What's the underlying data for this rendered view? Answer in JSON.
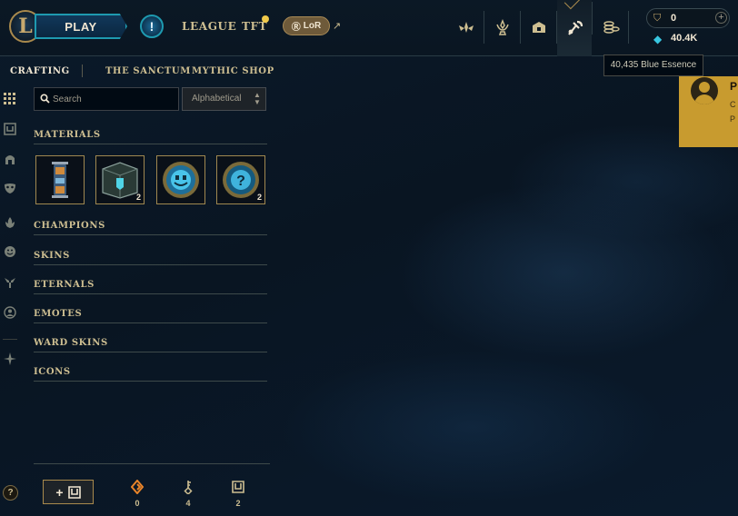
{
  "topbar": {
    "play_label": "PLAY",
    "alert_label": "!",
    "nav_league": "LEAGUE",
    "nav_tft": "TFT",
    "lor_label": "LoR",
    "lor_ext": "↗"
  },
  "wallet": {
    "rp_value": "0",
    "rp_add": "+",
    "be_value": "40.4K",
    "tooltip": "40,435 Blue Essence"
  },
  "notification": {
    "title": "P",
    "line1": "C",
    "line2": "P"
  },
  "subnav": {
    "crafting": "CRAFTING",
    "sanctum": "THE SANCTUM",
    "mythic_shop": "MYTHIC SHOP"
  },
  "search": {
    "placeholder": "Search"
  },
  "sort": {
    "selected": "Alphabetical"
  },
  "sections": {
    "materials": "MATERIALS",
    "champions": "CHAMPIONS",
    "skins": "SKINS",
    "eternals": "ETERNALS",
    "emotes": "EMOTES",
    "ward_skins": "WARD SKINS",
    "icons": "ICONS"
  },
  "materials": [
    {
      "name": "key-fragment",
      "count": ""
    },
    {
      "name": "hextech-chest",
      "count": "2"
    },
    {
      "name": "emote-capsule",
      "count": ""
    },
    {
      "name": "mystery-orb",
      "count": "2"
    }
  ],
  "bottom": {
    "add_label": "+",
    "orange_essence_count": "0",
    "key_count": "4",
    "chest_count": "2"
  },
  "help_label": "?",
  "colors": {
    "gold": "#c8aa6e",
    "blue_essence": "#38c6e0",
    "orange_essence": "#e8842a",
    "notification_bg": "#c89b2f",
    "play_border": "#1e9ab0"
  }
}
